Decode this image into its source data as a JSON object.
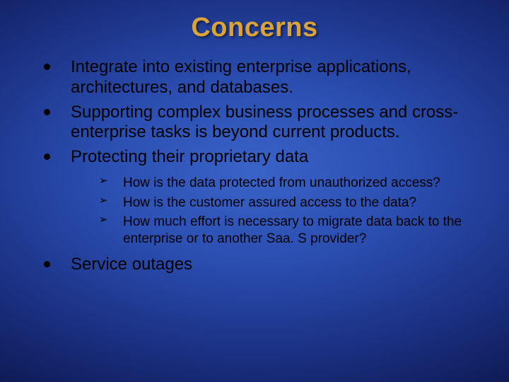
{
  "title": "Concerns",
  "bullets": {
    "b0": "Integrate into existing enterprise applications, architectures, and databases.",
    "b1": "Supporting complex business processes and cross-enterprise tasks is beyond current products.",
    "b2": "Protecting their proprietary data",
    "b2_sub": {
      "s0": "How is the data protected from unauthorized access?",
      "s1": "How is the customer assured access to the data?",
      "s2": "How much effort is necessary to migrate data back to the enterprise or to another Saa. S provider?"
    },
    "b3": "Service outages"
  }
}
